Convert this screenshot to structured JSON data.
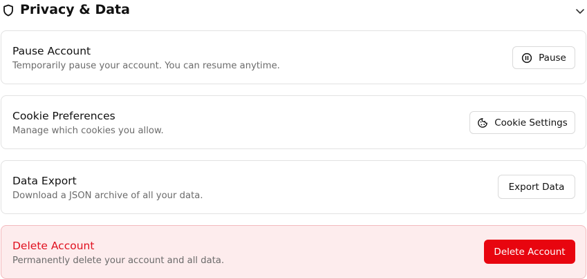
{
  "section": {
    "title": "Privacy & Data",
    "icon": "shield-icon",
    "toggle_icon": "chevron-down-icon"
  },
  "cards": {
    "pause": {
      "title": "Pause Account",
      "description": "Temporarily pause your account. You can resume anytime.",
      "button_label": "Pause",
      "button_icon": "pause-circle-icon"
    },
    "cookies": {
      "title": "Cookie Preferences",
      "description": "Manage which cookies you allow.",
      "button_label": "Cookie Settings",
      "button_icon": "cookie-icon"
    },
    "export": {
      "title": "Data Export",
      "description": "Download a JSON archive of all your data.",
      "button_label": "Export Data"
    },
    "delete": {
      "title": "Delete Account",
      "description": "Permanently delete your account and all data.",
      "button_label": "Delete Account"
    }
  },
  "colors": {
    "danger": "#e8050f",
    "danger_background": "#fdeced",
    "danger_border": "#f3b9bd",
    "muted_text": "#6b6b6b"
  }
}
